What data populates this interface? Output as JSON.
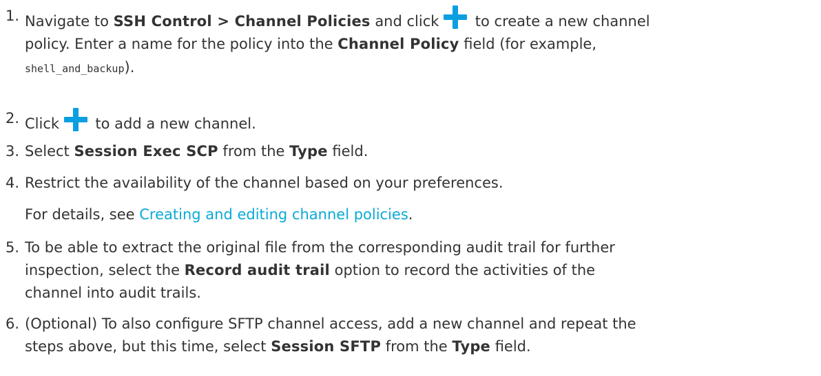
{
  "steps": [
    {
      "number": "1.",
      "l1_a": "Navigate to ",
      "l1_b": "SSH Control > Channel Policies",
      "l1_c": " and click ",
      "l1_d": " to create a new channel",
      "l2_a": "policy. Enter a name for the policy into the ",
      "l2_b": "Channel Policy",
      "l2_c": " field (for example,",
      "l3_code": "shell_and_backup",
      "l3_b": ")."
    },
    {
      "number": "2.",
      "a": "Click ",
      "b": " to add a new channel."
    },
    {
      "number": "3.",
      "a": "Select ",
      "b": "Session Exec SCP",
      "c": " from the ",
      "d": "Type",
      "e": " field."
    },
    {
      "number": "4.",
      "a": "Restrict the availability of the channel based on your preferences.",
      "detail_a": "For details, see ",
      "detail_link": "Creating and editing channel policies",
      "detail_b": "."
    },
    {
      "number": "5.",
      "l1": "To be able to extract the original file from the corresponding audit trail for further",
      "l2_a": "inspection, select the ",
      "l2_b": "Record audit trail",
      "l2_c": " option to record the activities of the",
      "l3": "channel into audit trails."
    },
    {
      "number": "6.",
      "l1": "(Optional) To also configure SFTP channel access, add a new channel and repeat the",
      "l2_a": "steps above, but this time, select ",
      "l2_b": "Session SFTP",
      "l2_c": " from the ",
      "l2_d": "Type",
      "l2_e": " field."
    }
  ],
  "icons": {
    "add": "plus-icon",
    "add_color": "#0a9fe0"
  },
  "colors": {
    "text": "#333333",
    "link": "#0aa9d6"
  }
}
